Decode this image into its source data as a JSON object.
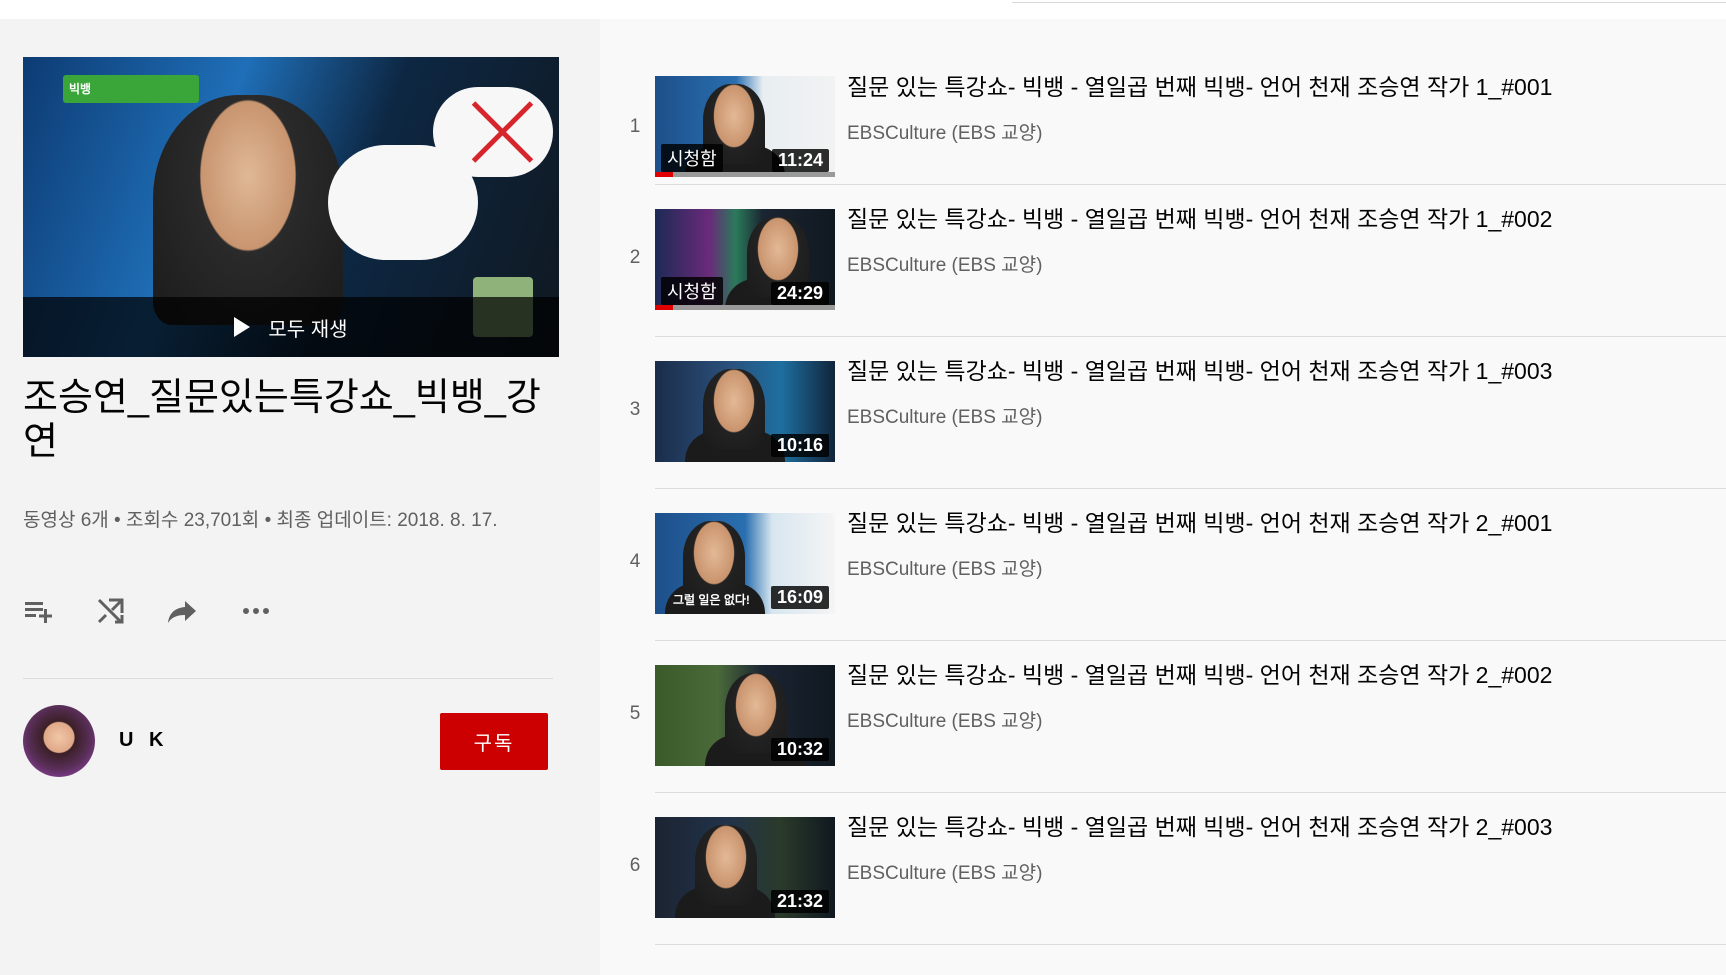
{
  "playlist": {
    "title": "조승연_질문있는특강쇼_빅뱅_강연",
    "stats": "동영상 6개 • 조회수 23,701회 • 최종 업데이트: 2018. 8. 17.",
    "play_all_label": "모두 재생",
    "hero_logo_text": "빅뱅",
    "actions": [
      "add-to-queue-icon",
      "shuffle-icon",
      "share-icon",
      "more-icon"
    ],
    "owner": {
      "name": "U K",
      "subscribe_label": "구독"
    }
  },
  "videos": [
    {
      "index": "1",
      "title": "질문 있는 특강쇼- 빅뱅 - 열일곱 번째 빅뱅- 언어 천재 조승연 작가 1_#001",
      "channel": "EBSCulture (EBS 교양)",
      "duration": "11:24",
      "watched_label": "시청함",
      "progress_fraction": 0.1
    },
    {
      "index": "2",
      "title": "질문 있는 특강쇼- 빅뱅 - 열일곱 번째 빅뱅- 언어 천재 조승연 작가 1_#002",
      "channel": "EBSCulture (EBS 교양)",
      "duration": "24:29",
      "watched_label": "시청함",
      "progress_fraction": 0.1
    },
    {
      "index": "3",
      "title": "질문 있는 특강쇼- 빅뱅 - 열일곱 번째 빅뱅- 언어 천재 조승연 작가 1_#003",
      "channel": "EBSCulture (EBS 교양)",
      "duration": "10:16",
      "watched_label": "",
      "progress_fraction": 0
    },
    {
      "index": "4",
      "title": "질문 있는 특강쇼- 빅뱅 - 열일곱 번째 빅뱅- 언어 천재 조승연 작가 2_#001",
      "channel": "EBSCulture (EBS 교양)",
      "duration": "16:09",
      "watched_label": "",
      "progress_fraction": 0,
      "caption": "그럴 일은 없다!"
    },
    {
      "index": "5",
      "title": "질문 있는 특강쇼- 빅뱅 - 열일곱 번째 빅뱅- 언어 천재 조승연 작가 2_#002",
      "channel": "EBSCulture (EBS 교양)",
      "duration": "10:32",
      "watched_label": "",
      "progress_fraction": 0
    },
    {
      "index": "6",
      "title": "질문 있는 특강쇼- 빅뱅 - 열일곱 번째 빅뱅- 언어 천재 조승연 작가 2_#003",
      "channel": "EBSCulture (EBS 교양)",
      "duration": "21:32",
      "watched_label": "",
      "progress_fraction": 0
    }
  ],
  "colors": {
    "subscribe": "#cc0000",
    "progress": "#e00000"
  }
}
